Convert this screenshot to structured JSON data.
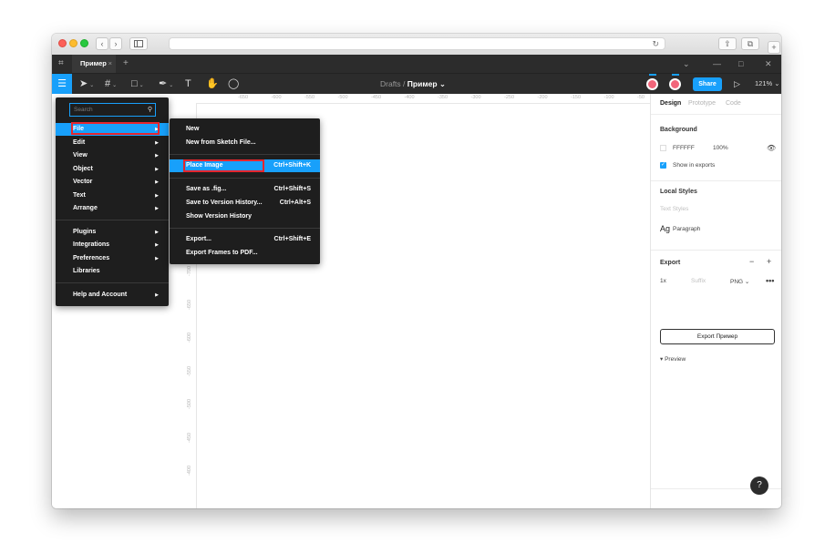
{
  "tab": {
    "title": "Пример",
    "close": "×",
    "add": "+"
  },
  "toolbar": {
    "breadcrumb_parent": "Drafts",
    "breadcrumb_sep": "/",
    "file_name": "Пример",
    "file_chev": "⌄",
    "share": "Share",
    "zoom": "121%",
    "zoom_chev": "⌄"
  },
  "ruler": {
    "top": [
      "-650",
      "-600",
      "-550",
      "-500",
      "-450",
      "-400",
      "-350",
      "-300",
      "-250",
      "-200",
      "-150",
      "-100",
      "-50",
      "0",
      "50"
    ],
    "left": [
      "-700",
      "-650",
      "-600",
      "-550",
      "-500",
      "-450",
      "-400"
    ]
  },
  "main_menu": {
    "search_placeholder": "Search",
    "groups": [
      [
        "File",
        "Edit",
        "View",
        "Object",
        "Vector",
        "Text",
        "Arrange"
      ],
      [
        "Plugins",
        "Integrations",
        "Preferences",
        "Libraries"
      ],
      [
        "Help and Account"
      ]
    ]
  },
  "file_menu": {
    "groups": [
      [
        {
          "label": "New",
          "shortcut": ""
        },
        {
          "label": "New from Sketch File...",
          "shortcut": ""
        }
      ],
      [
        {
          "label": "Place Image",
          "shortcut": "Ctrl+Shift+K"
        }
      ],
      [
        {
          "label": "Save as .fig...",
          "shortcut": "Ctrl+Shift+S"
        },
        {
          "label": "Save to Version History...",
          "shortcut": "Ctrl+Alt+S"
        },
        {
          "label": "Show Version History",
          "shortcut": ""
        }
      ],
      [
        {
          "label": "Export...",
          "shortcut": "Ctrl+Shift+E"
        },
        {
          "label": "Export Frames to PDF...",
          "shortcut": ""
        }
      ]
    ]
  },
  "panel": {
    "tabs": [
      "Design",
      "Prototype",
      "Code"
    ],
    "background": {
      "title": "Background",
      "hex": "FFFFFF",
      "opacity": "100%",
      "show_in_exports": "Show in exports"
    },
    "local_styles": {
      "title": "Local Styles",
      "text_styles": "Text Styles",
      "ag": "Ag",
      "paragraph": "Paragraph"
    },
    "export": {
      "title": "Export",
      "scale": "1x",
      "suffix_placeholder": "Suffix",
      "format": "PNG",
      "format_chev": "⌄",
      "button": "Export Пример",
      "preview": "Preview"
    }
  },
  "help": "?",
  "colors": {
    "accent": "#18a0fb",
    "toolbar": "#2c2c2c",
    "menu": "#1e1e1e",
    "highlight": "#e5262e"
  }
}
